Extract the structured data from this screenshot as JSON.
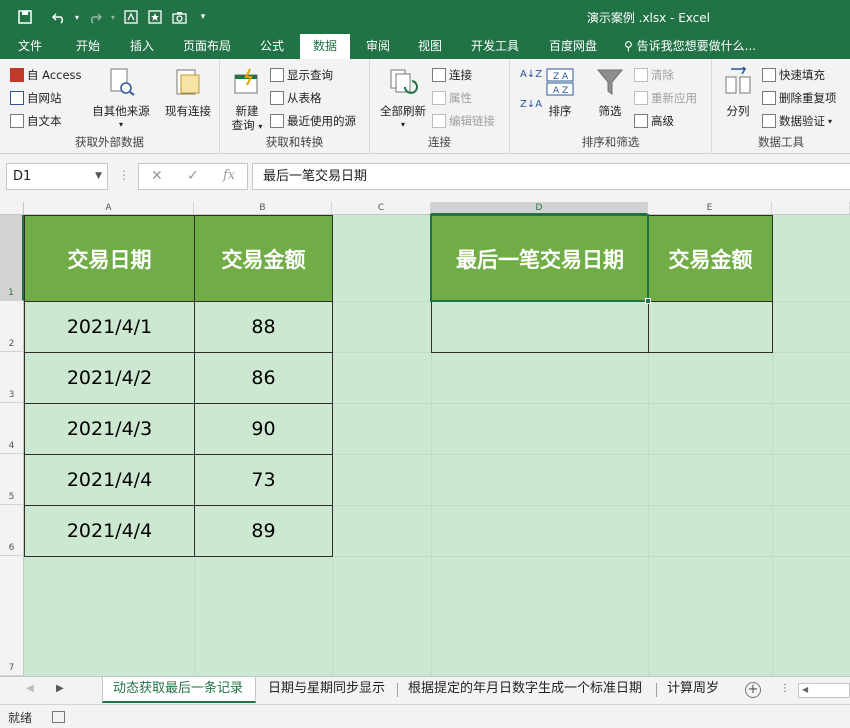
{
  "app": {
    "title": "演示案例 .xlsx - Excel",
    "accent": "#217346"
  },
  "qat": {
    "icons": [
      "save-icon",
      "undo-icon",
      "redo-icon",
      "screen-icon",
      "star-icon",
      "camera-icon",
      "customize-icon"
    ]
  },
  "tabs": {
    "file": "文件",
    "home": "开始",
    "insert": "插入",
    "layout": "页面布局",
    "formulas": "公式",
    "data": "数据",
    "review": "审阅",
    "view": "视图",
    "developer": "开发工具",
    "baidu": "百度网盘",
    "tellme": "告诉我您想要做什么..."
  },
  "ribbon": {
    "external": {
      "access": "自 Access",
      "web": "自网站",
      "text": "自文本",
      "other": "自其他来源",
      "existing": "现有连接",
      "label": "获取外部数据"
    },
    "transform": {
      "newquery": "新建",
      "newquery2": "查询",
      "showquery": "显示查询",
      "fromtable": "从表格",
      "recent": "最近使用的源",
      "label": "获取和转换"
    },
    "connections": {
      "refresh": "全部刷新",
      "connect": "连接",
      "props": "属性",
      "editlinks": "编辑链接",
      "label": "连接"
    },
    "sort": {
      "sort": "排序",
      "filter": "筛选",
      "clear": "清除",
      "reapply": "重新应用",
      "advanced": "高级",
      "label": "排序和筛选"
    },
    "tools": {
      "split": "分列",
      "flash": "快速填充",
      "dedup": "删除重复项",
      "validate": "数据验证",
      "label": "数据工具"
    }
  },
  "formula_bar": {
    "name_box": "D1",
    "formula": "最后一笔交易日期"
  },
  "columns": [
    "A",
    "B",
    "C",
    "D",
    "E"
  ],
  "rows": [
    "1",
    "2",
    "3",
    "4",
    "5",
    "6",
    "7"
  ],
  "sheet": {
    "header_color": "#70ad47",
    "background_color": "#cde8d1",
    "a1": "交易日期",
    "b1": "交易金额",
    "d1": "最后一笔交易日期",
    "e1": "交易金额",
    "data": [
      {
        "date": "2021/4/1",
        "amount": "88"
      },
      {
        "date": "2021/4/2",
        "amount": "86"
      },
      {
        "date": "2021/4/3",
        "amount": "90"
      },
      {
        "date": "2021/4/4",
        "amount": "73"
      },
      {
        "date": "2021/4/4",
        "amount": "89"
      }
    ]
  },
  "sheet_tabs": {
    "tab1": "动态获取最后一条记录",
    "tab2": "日期与星期同步显示",
    "tab3": "根据提定的年月日数字生成一个标准日期",
    "tab4": "计算周岁"
  },
  "status": {
    "ready": "就绪"
  }
}
